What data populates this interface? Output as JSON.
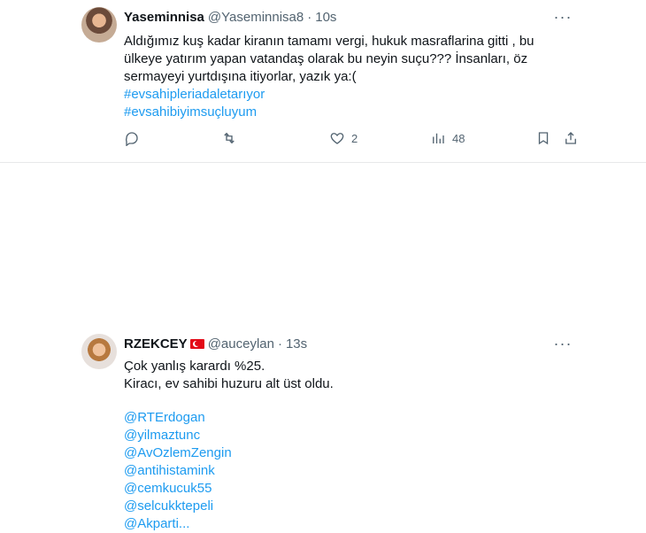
{
  "tweets": [
    {
      "display_name": "Yaseminnisa",
      "handle": "@Yaseminnisa8",
      "separator": "·",
      "time": "10s",
      "more_icon": "more-options-icon",
      "text_lines": [
        "Aldığımız kuş kadar kiranın tamamı vergi, hukuk masraflarina gitti , bu",
        "ülkeye yatırım yapan vatandaş olarak bu neyin suçu??? İnsanları, öz",
        "sermayeyi yurtdışına itiyorlar, yazık ya:("
      ],
      "hashtags": [
        "#evsahipleriadaletarıyor",
        "#evsahibiyimsuçluyum"
      ],
      "actions": {
        "reply_icon": "reply-icon",
        "retweet_icon": "retweet-icon",
        "like_icon": "heart-icon",
        "like_count": "2",
        "views_icon": "views-chart-icon",
        "views_count": "48",
        "bookmark_icon": "bookmark-icon",
        "share_icon": "share-icon"
      }
    },
    {
      "display_name": "RZEKCEY",
      "flag_icon": "turkey-flag-icon",
      "handle": "@auceylan",
      "separator": "·",
      "time": "13s",
      "more_icon": "more-options-icon",
      "text_lines": [
        "Çok yanlış karardı %25.",
        "Kiracı, ev sahibi huzuru alt üst oldu."
      ],
      "mentions": [
        "@RTErdogan",
        "@yilmaztunc",
        "@AvOzlemZengin",
        "@antihistamink",
        "@cemkucuk55",
        "@selcukktepeli",
        "@Akparti..."
      ]
    }
  ],
  "colors": {
    "text": "#0f1419",
    "secondary": "#536471",
    "link": "#1d9bf0",
    "divider": "#e7e9ea"
  }
}
